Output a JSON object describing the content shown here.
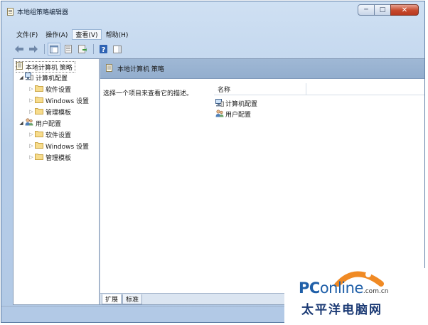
{
  "window": {
    "title": "本地组策略编辑器"
  },
  "window_buttons": {
    "minimize": "─",
    "maximize": "□",
    "close": "✕"
  },
  "menu": [
    {
      "label": "文件(F)"
    },
    {
      "label": "操作(A)"
    },
    {
      "label": "查看(V)"
    },
    {
      "label": "帮助(H)"
    }
  ],
  "toolbar": {
    "icons": [
      "back-arrow-icon",
      "forward-arrow-icon",
      "show-console-tree-icon",
      "properties-icon",
      "export-list-icon",
      "help-icon",
      "action-pane-icon"
    ]
  },
  "tree": {
    "root": "本地计算机 策略",
    "computer": {
      "label": "计算机配置",
      "children": [
        "软件设置",
        "Windows 设置",
        "管理模板"
      ]
    },
    "user": {
      "label": "用户配置",
      "children": [
        "软件设置",
        "Windows 设置",
        "管理模板"
      ]
    }
  },
  "details": {
    "header": "本地计算机 策略",
    "description": "选择一个项目来查看它的描述。",
    "column_name": "名称",
    "items": [
      "计算机配置",
      "用户配置"
    ]
  },
  "tabs": [
    "扩展",
    "标准"
  ],
  "watermark": {
    "brand_pc": "PC",
    "brand_online": "online",
    "brand_domain": ".com.cn",
    "chinese": "太平洋电脑网"
  },
  "colors": {
    "header_bg": "#9fb8d5",
    "close_button": "#c6482b",
    "brand_blue": "#1f5fa8",
    "brand_orange": "#f08a24"
  }
}
